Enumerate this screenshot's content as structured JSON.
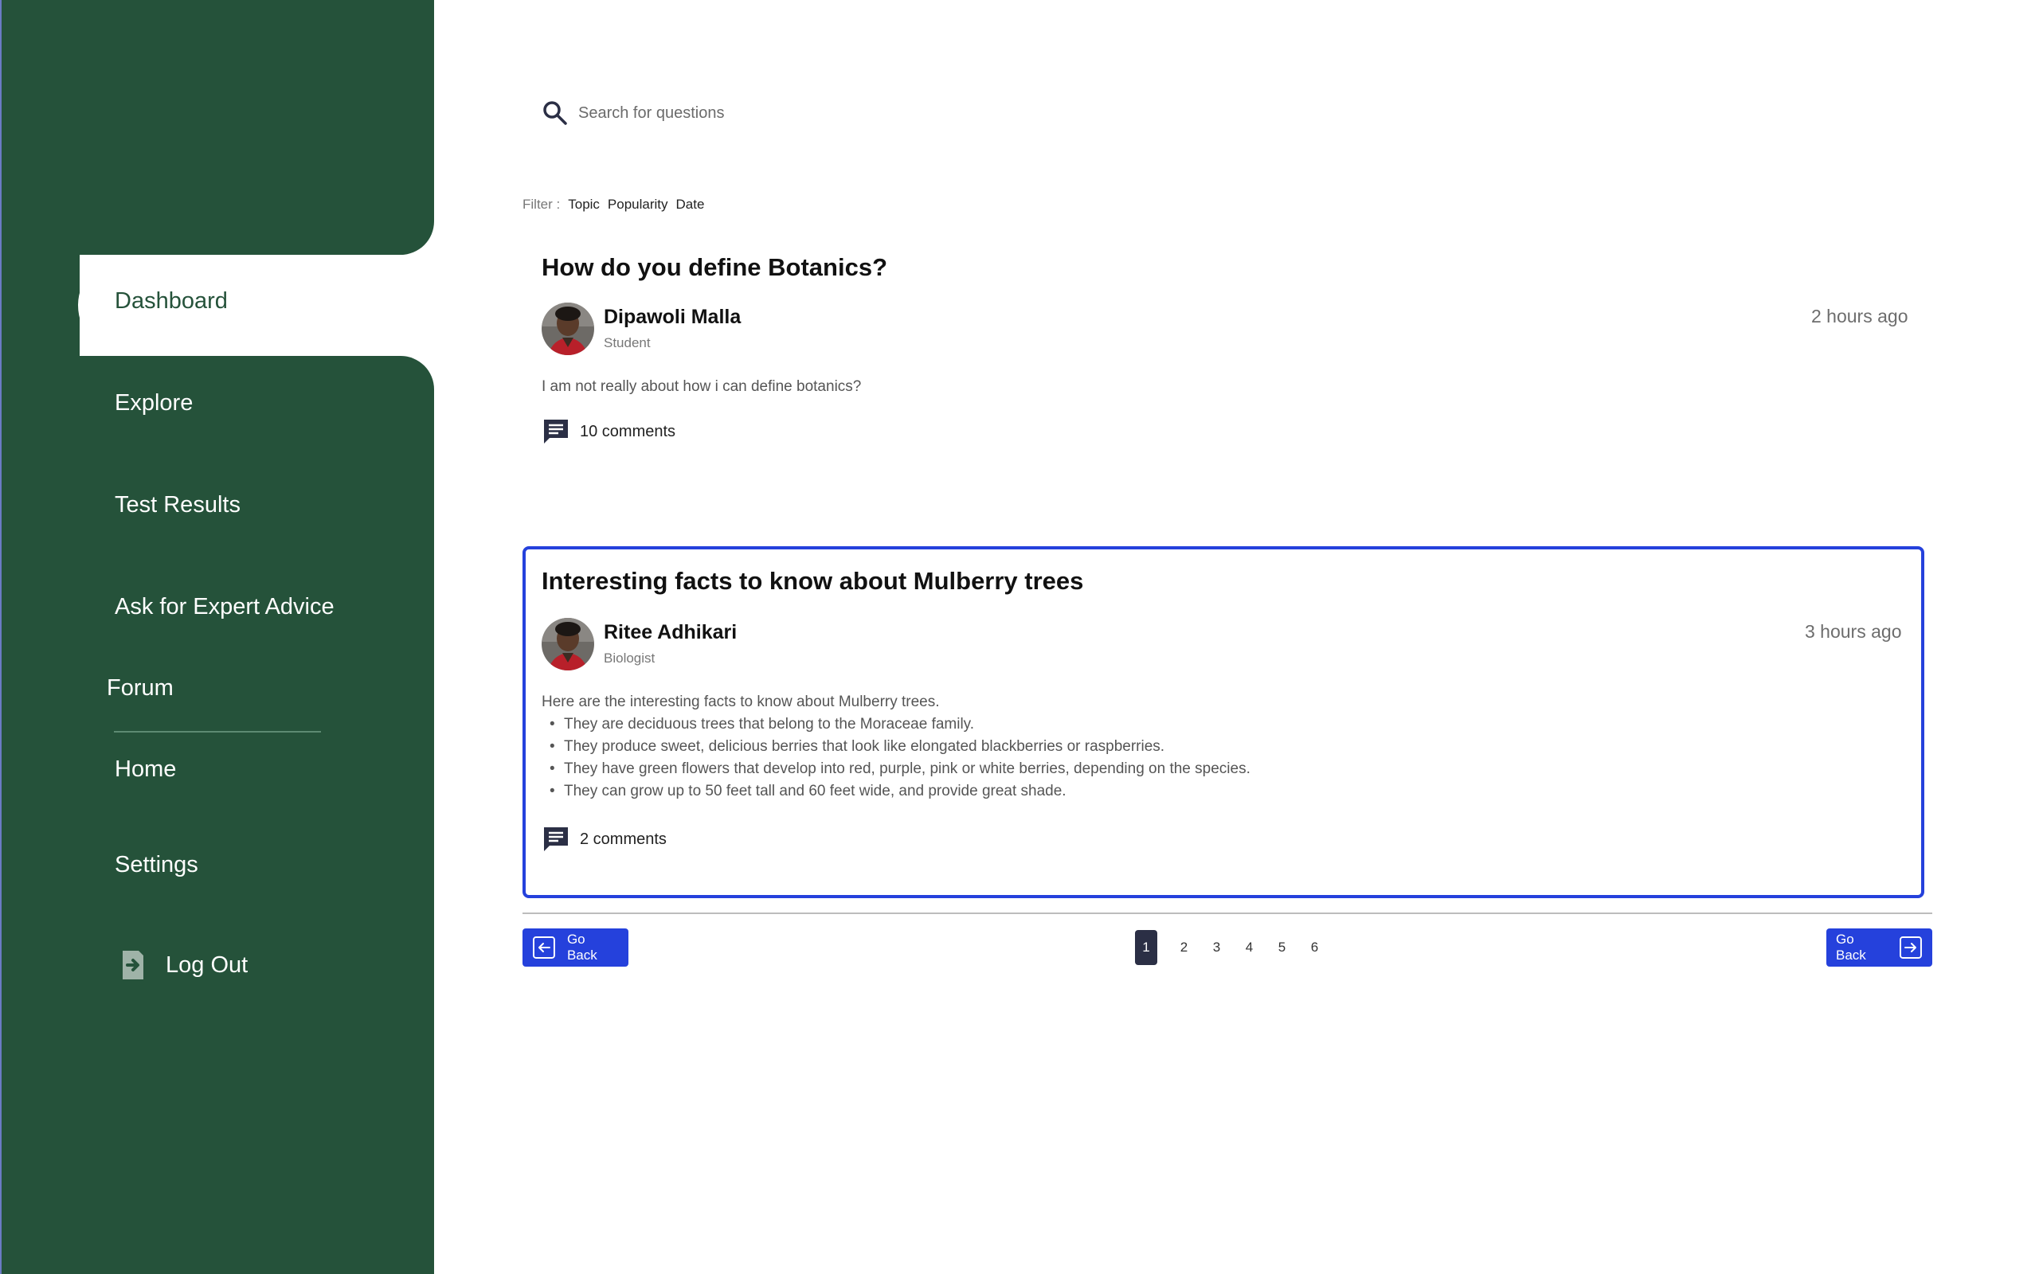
{
  "sidebar": {
    "items": [
      {
        "label": "Dashboard",
        "active": true
      },
      {
        "label": "Explore"
      },
      {
        "label": "Test Results"
      },
      {
        "label": "Ask for Expert Advice"
      },
      {
        "label": "Forum"
      },
      {
        "label": "Home"
      },
      {
        "label": "Settings"
      },
      {
        "label": "Log Out",
        "icon": "logout-icon"
      }
    ]
  },
  "search": {
    "placeholder": "Search for questions",
    "value": ""
  },
  "filter": {
    "label": "Filter :",
    "options": [
      "Topic",
      "Popularity",
      "Date"
    ]
  },
  "posts": [
    {
      "title": "How do you define Botanics?",
      "author": "Dipawoli Malla",
      "role": "Student",
      "time": "2 hours ago",
      "body": "I am not really about how i can define botanics?",
      "comments": "10 comments"
    },
    {
      "title": "Interesting facts to know about Mulberry trees",
      "author": "Ritee Adhikari",
      "role": "Biologist",
      "time": "3 hours ago",
      "body": "Here are the interesting facts to know about Mulberry trees.",
      "bullets": [
        "They are deciduous trees that belong to the Moraceae family.",
        "They produce sweet, delicious berries that look like elongated blackberries or raspberries.",
        "They have green flowers that develop into red, purple, pink or white berries, depending on the species.",
        "They can grow up to 50 feet tall and 60 feet wide, and provide great shade."
      ],
      "comments": "2 comments"
    }
  ],
  "pagination": {
    "back_label": "Go Back",
    "next_label": "Go Back",
    "pages": [
      "1",
      "2",
      "3",
      "4",
      "5",
      "6"
    ],
    "current": "1"
  },
  "colors": {
    "sidebar": "#25523a",
    "accent": "#2541dc",
    "active_page": "#2b2f45"
  }
}
